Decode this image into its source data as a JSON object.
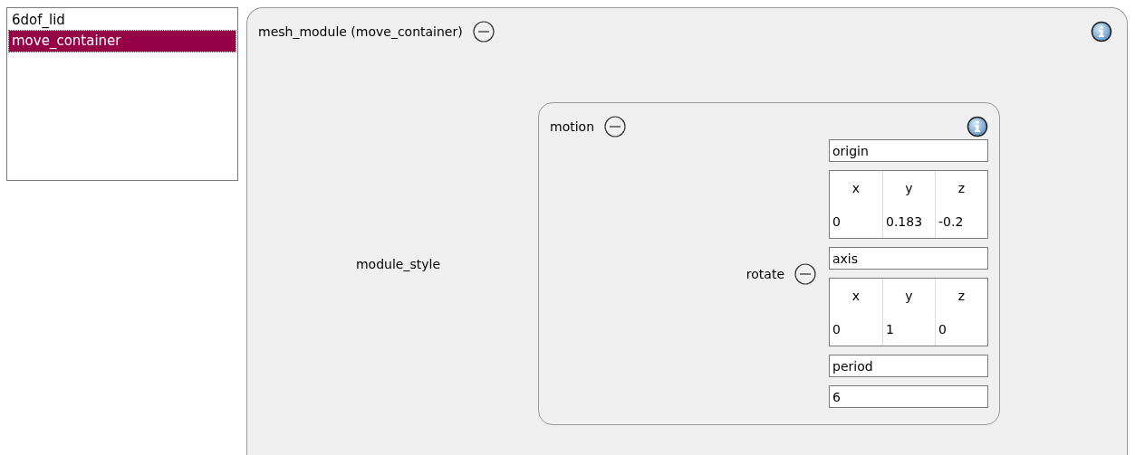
{
  "list": {
    "items": [
      {
        "label": "6dof_lid",
        "selected": false
      },
      {
        "label": "move_container",
        "selected": true
      }
    ]
  },
  "panel": {
    "title": "mesh_module (move_container)",
    "field_label": "module_style",
    "motion": {
      "title": "motion",
      "rotate": {
        "label": "rotate",
        "fields": [
          {
            "kind": "text",
            "value": "origin"
          },
          {
            "kind": "vector",
            "columns": [
              "x",
              "y",
              "z"
            ],
            "values": [
              "0",
              "0.183",
              "-0.2"
            ]
          },
          {
            "kind": "text",
            "value": "axis"
          },
          {
            "kind": "vector",
            "columns": [
              "x",
              "y",
              "z"
            ],
            "values": [
              "0",
              "1",
              "0"
            ]
          },
          {
            "kind": "text",
            "value": "period"
          },
          {
            "kind": "text",
            "value": "6"
          }
        ]
      }
    }
  }
}
